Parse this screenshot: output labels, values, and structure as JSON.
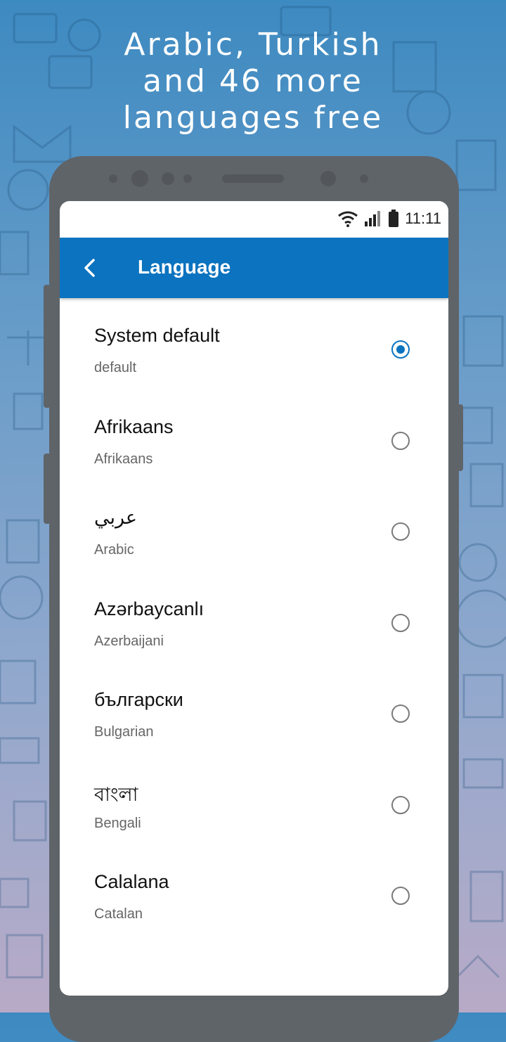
{
  "promo": {
    "headline_lines": [
      "Arabic, Turkish",
      "and 46 more",
      "languages free"
    ]
  },
  "status_bar": {
    "time": "11:11",
    "icons": [
      "wifi-icon",
      "signal-icon",
      "battery-icon"
    ]
  },
  "app_bar": {
    "title": "Language",
    "back_icon": "back-chevron-icon",
    "color": "#0b73bf"
  },
  "languages": [
    {
      "name": "System default",
      "subtitle": "default",
      "selected": true
    },
    {
      "name": "Afrikaans",
      "subtitle": "Afrikaans",
      "selected": false
    },
    {
      "name": "عربي",
      "subtitle": "Arabic",
      "selected": false
    },
    {
      "name": "Azərbaycanlı",
      "subtitle": "Azerbaijani",
      "selected": false
    },
    {
      "name": "български",
      "subtitle": "Bulgarian",
      "selected": false
    },
    {
      "name": "বাংলা",
      "subtitle": "Bengali",
      "selected": false
    },
    {
      "name": "Calalana",
      "subtitle": "Catalan",
      "selected": false
    }
  ]
}
